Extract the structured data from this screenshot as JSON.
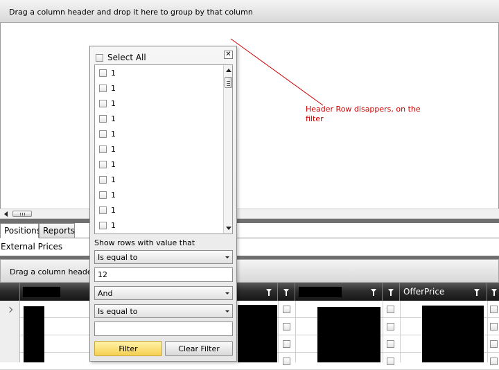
{
  "top_group_panel": {
    "text": "Drag a column header and drop it here to group by that column"
  },
  "annotation": {
    "text": "Header Row disappers, on the filter",
    "color": "#cc0000"
  },
  "tabs": [
    {
      "label": "Positions"
    },
    {
      "label": "Reports"
    }
  ],
  "section_title": "External Prices",
  "second_group_panel": {
    "text": "Drag a column header a"
  },
  "grid": {
    "offer_column": "OfferPrice"
  },
  "filter_popup": {
    "close_glyph": "✕",
    "select_all": "Select All",
    "items": [
      "1",
      "1",
      "1",
      "1",
      "1",
      "1",
      "1",
      "1",
      "1",
      "1",
      "1"
    ],
    "show_rows_label": "Show rows with value that",
    "operator1": "Is equal to",
    "value1": "12",
    "logic": "And",
    "operator2": "Is equal to",
    "value2": "",
    "filter_button": "Filter",
    "clear_button": "Clear Filter",
    "accent_color": "#f6cf52"
  }
}
